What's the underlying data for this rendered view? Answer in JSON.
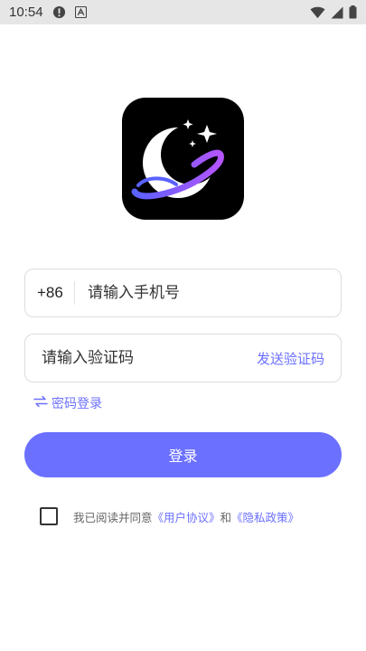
{
  "status_bar": {
    "time": "10:54"
  },
  "login": {
    "country_code": "+86",
    "phone_placeholder": "请输入手机号",
    "code_placeholder": "请输入验证码",
    "send_code_label": "发送验证码",
    "password_login_label": "密码登录",
    "login_button_label": "登录"
  },
  "agreement": {
    "prefix": "我已阅读并同意",
    "user_agreement": "《用户协议》",
    "and": "和",
    "privacy_policy": "《隐私政策》"
  },
  "colors": {
    "accent": "#6b70ff",
    "status_bar_bg": "#e6e6e6",
    "logo_bg": "#000000"
  }
}
